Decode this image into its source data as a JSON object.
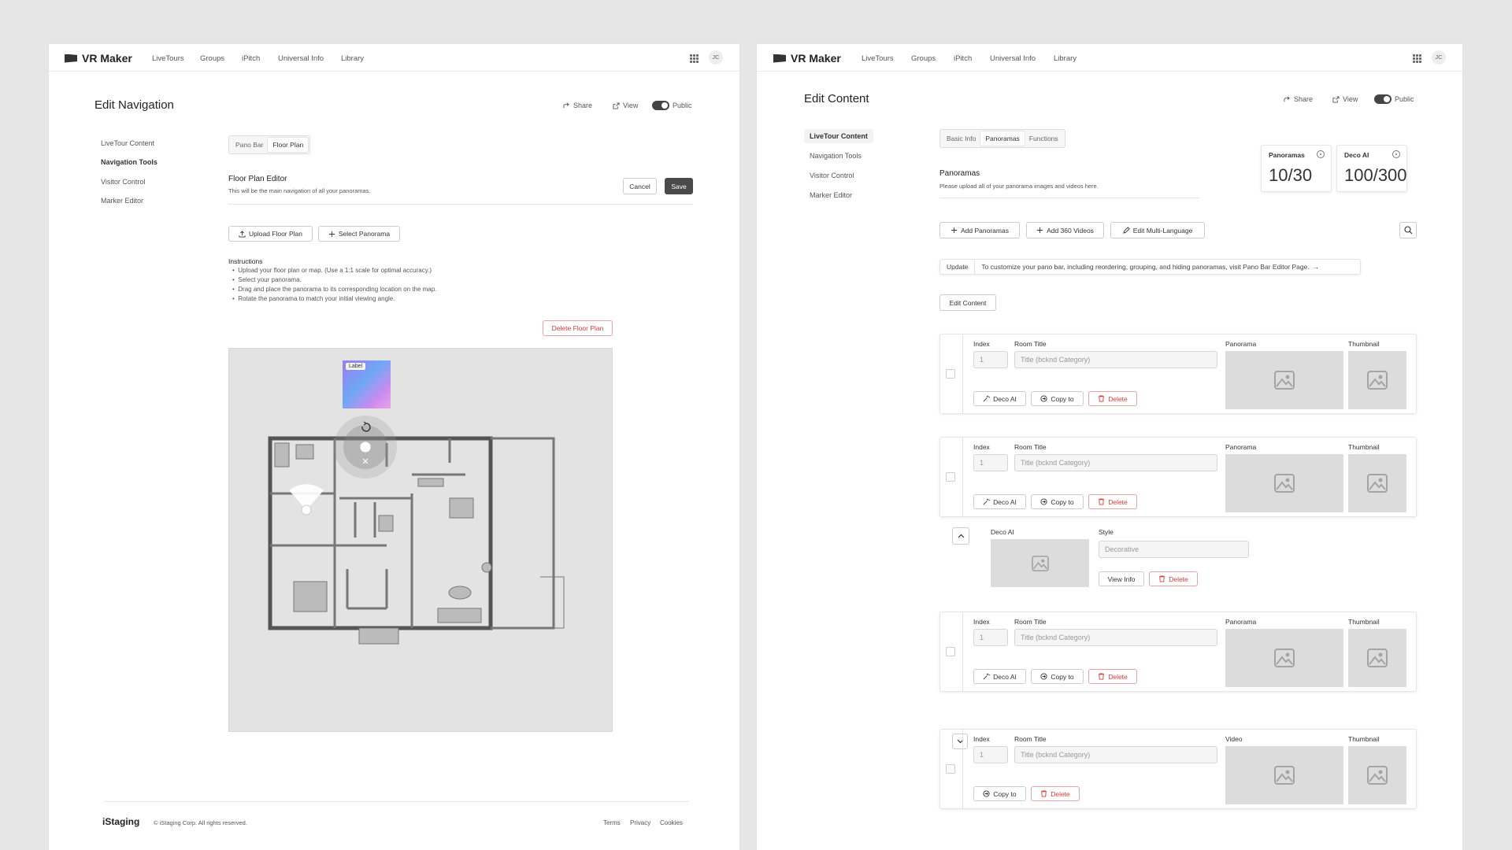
{
  "app": {
    "name": "VR Maker",
    "avatar_initials": "JC"
  },
  "nav_links": [
    "LiveTours",
    "Groups",
    "iPitch",
    "Universal Info",
    "Library"
  ],
  "header_actions": {
    "share": "Share",
    "view": "View",
    "public": "Public"
  },
  "sidebar": [
    "LiveTour Content",
    "Navigation Tools",
    "Visitor Control",
    "Marker Editor"
  ],
  "left": {
    "title": "Edit Navigation",
    "active_sidebar": "Navigation Tools",
    "tabs": [
      "Pano Bar",
      "Floor Plan"
    ],
    "active_tab": "Floor Plan",
    "editor_title": "Floor Plan Editor",
    "editor_desc": "This will be the main navigation of all your panoramas.",
    "cancel": "Cancel",
    "save": "Save",
    "upload": "Upload Floor Plan",
    "select": "Select Panorama",
    "instructions_title": "Instructions",
    "instructions": [
      "Upload your floor plan or map. (Use a 1:1 scale for optimal accuracy.)",
      "Select your panorama.",
      "Drag and place the panorama to its corresponding location on the map.",
      "Rotate the panorama to match your initial viewing angle."
    ],
    "delete_floor_plan": "Delete Floor Plan",
    "marker_label": "Label",
    "footer": {
      "brand": "iStaging",
      "copyright": "© iStaging Corp. All rights reserved.",
      "links": [
        "Terms",
        "Privacy",
        "Cookies"
      ]
    }
  },
  "right": {
    "title": "Edit Content",
    "active_sidebar": "LiveTour Content",
    "tabs": [
      "Basic Info",
      "Panoramas",
      "Functions"
    ],
    "active_tab": "Panoramas",
    "section_title": "Panoramas",
    "section_desc": "Please upload all of your panorama images and videos here.",
    "stats": [
      {
        "label": "Panoramas",
        "value": "10/30"
      },
      {
        "label": "Deco AI",
        "value": "100/300"
      }
    ],
    "actions": [
      "Add Panoramas",
      "Add 360 Videos",
      "Edit Multi-Language"
    ],
    "update_badge": "Update",
    "update_text": "To customize your pano bar, including reordering, grouping, and hiding panoramas, visit Pano Bar Editor Page.",
    "edit_content": "Edit Content",
    "labels": {
      "index": "Index",
      "room_title": "Room Title",
      "panorama": "Panorama",
      "thumbnail": "Thumbnail",
      "video": "Video",
      "deco_ai": "Deco AI",
      "style": "Style"
    },
    "index_placeholder": "1",
    "title_placeholder": "Title (bcknd Category)",
    "style_placeholder": "Decorative",
    "row_buttons": {
      "deco_ai": "Deco AI",
      "copy_to": "Copy to",
      "delete": "Delete",
      "view_info": "View Info"
    }
  }
}
